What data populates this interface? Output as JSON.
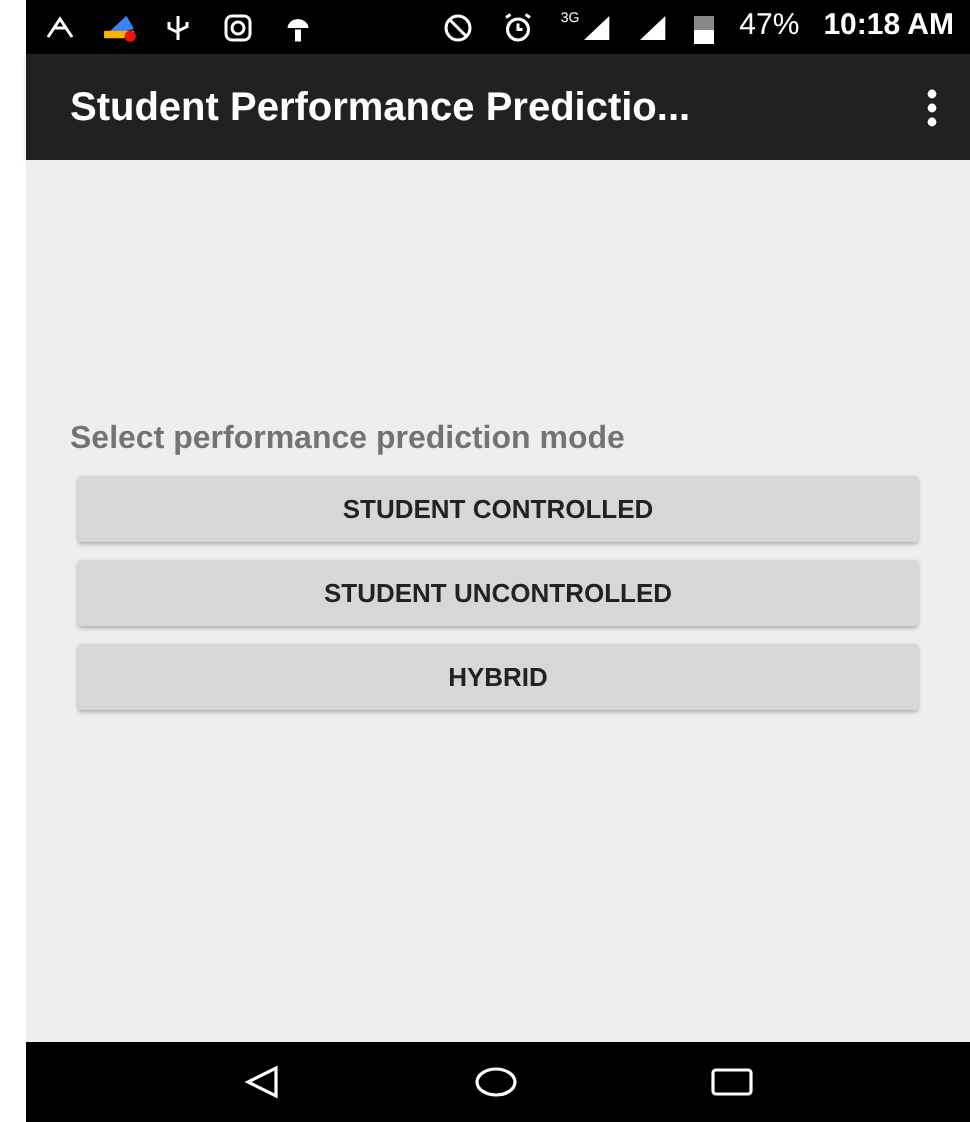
{
  "status_bar": {
    "network": "3G",
    "battery": "47%",
    "time": "10:18 AM"
  },
  "app_bar": {
    "title": "Student Performance Predictio..."
  },
  "content": {
    "prompt": "Select performance prediction mode",
    "buttons": [
      "STUDENT CONTROLLED",
      "STUDENT UNCONTROLLED",
      "HYBRID"
    ]
  }
}
